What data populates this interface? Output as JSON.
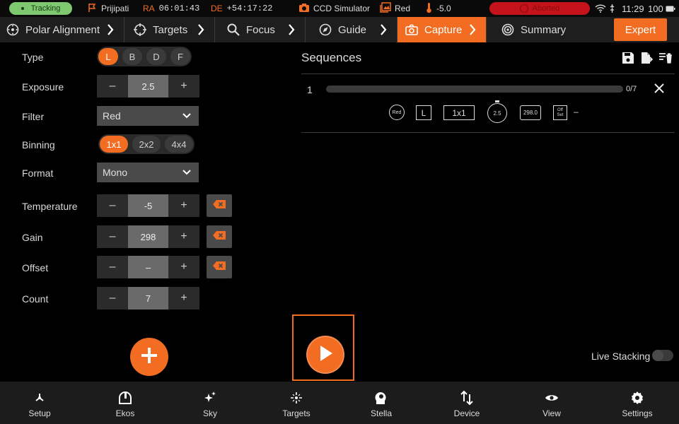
{
  "status": {
    "tracking": "Tracking",
    "site": "Prijipati",
    "ra_label": "RA",
    "ra_value": "06:01:43",
    "de_label": "DE",
    "de_value": "+54:17:22",
    "camera": "CCD Simulator",
    "filter": "Red",
    "temperature": "-5.0",
    "capture_state": "Aborted",
    "time": "11:29",
    "battery": "100"
  },
  "tabs": [
    {
      "label": "Polar Alignment",
      "icon": "polar-alignment-icon"
    },
    {
      "label": "Targets",
      "icon": "crosshair-icon"
    },
    {
      "label": "Focus",
      "icon": "search-icon"
    },
    {
      "label": "Guide",
      "icon": "compass-icon"
    },
    {
      "label": "Capture",
      "icon": "camera-icon",
      "active": true
    },
    {
      "label": "Summary",
      "icon": "target-icon"
    }
  ],
  "expert_label": "Expert",
  "form": {
    "type": {
      "label": "Type",
      "options": [
        "L",
        "B",
        "D",
        "F"
      ],
      "selected": "L"
    },
    "exposure": {
      "label": "Exposure",
      "value": "2.5",
      "minus": "–",
      "plus": "+"
    },
    "filter": {
      "label": "Filter",
      "value": "Red"
    },
    "binning": {
      "label": "Binning",
      "options": [
        "1x1",
        "2x2",
        "4x4"
      ],
      "selected": "1x1"
    },
    "format": {
      "label": "Format",
      "value": "Mono"
    },
    "temperature": {
      "label": "Temperature",
      "value": "-5",
      "minus": "–",
      "plus": "+"
    },
    "gain": {
      "label": "Gain",
      "value": "298",
      "minus": "–",
      "plus": "+"
    },
    "offset": {
      "label": "Offset",
      "value": "–",
      "minus": "–",
      "plus": "+"
    },
    "count": {
      "label": "Count",
      "value": "7",
      "minus": "–",
      "plus": "+"
    }
  },
  "sequences": {
    "title": "Sequences",
    "items": [
      {
        "index": "1",
        "progress_text": "0/7",
        "progress_fraction": 0,
        "filter": "Red",
        "type": "L",
        "binning": "1x1",
        "exposure": "2.5",
        "gain": "298.0",
        "offset_line1": "Off",
        "offset_line2": "Set",
        "offset_value": "–"
      }
    ]
  },
  "live_stacking": {
    "label": "Live Stacking",
    "enabled": false
  },
  "bottom_nav": [
    {
      "label": "Setup",
      "icon": "setup-icon"
    },
    {
      "label": "Ekos",
      "icon": "observatory-icon"
    },
    {
      "label": "Sky",
      "icon": "sparkle-icon"
    },
    {
      "label": "Targets",
      "icon": "targets-icon"
    },
    {
      "label": "Stella",
      "icon": "stella-icon"
    },
    {
      "label": "Device",
      "icon": "device-icon"
    },
    {
      "label": "View",
      "icon": "eye-icon"
    },
    {
      "label": "Settings",
      "icon": "gear-icon"
    }
  ],
  "colors": {
    "accent": "#f26d21",
    "tracking": "#7ec86f",
    "aborted": "#c4131a",
    "panel": "#1e1e1e"
  }
}
